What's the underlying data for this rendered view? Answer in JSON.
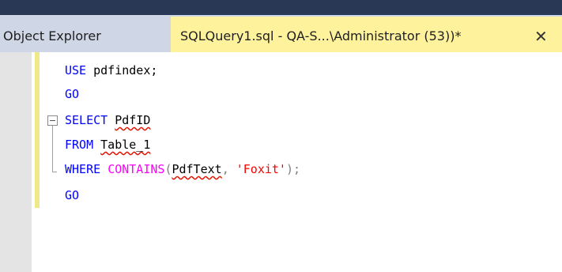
{
  "tabs": {
    "object_explorer": "Object Explorer",
    "query_tab_title": "SQLQuery1.sql - QA-S...\\Administrator (53))*",
    "close_glyph": "✕"
  },
  "editor": {
    "line1": {
      "kw": "USE",
      "text": " pdfindex;"
    },
    "line2": {
      "kw": "GO"
    },
    "line3": {
      "kw": "SELECT",
      "sp": " ",
      "ident": "PdfID"
    },
    "line4": {
      "kw": "FROM",
      "sp": " ",
      "ident": "Table_1"
    },
    "line5": {
      "kw": "WHERE",
      "sp": " ",
      "fn": "CONTAINS",
      "open": "(",
      "ident": "PdfText",
      "comma": ", ",
      "str": "'Foxit'",
      "close": ");"
    },
    "line6": {
      "kw": "GO"
    }
  },
  "colors": {
    "keyword": "#0000ff",
    "function": "#ff00ff",
    "string": "#ff0000",
    "active_tab": "#fff29d",
    "tab_bar": "#cfd6e5"
  }
}
